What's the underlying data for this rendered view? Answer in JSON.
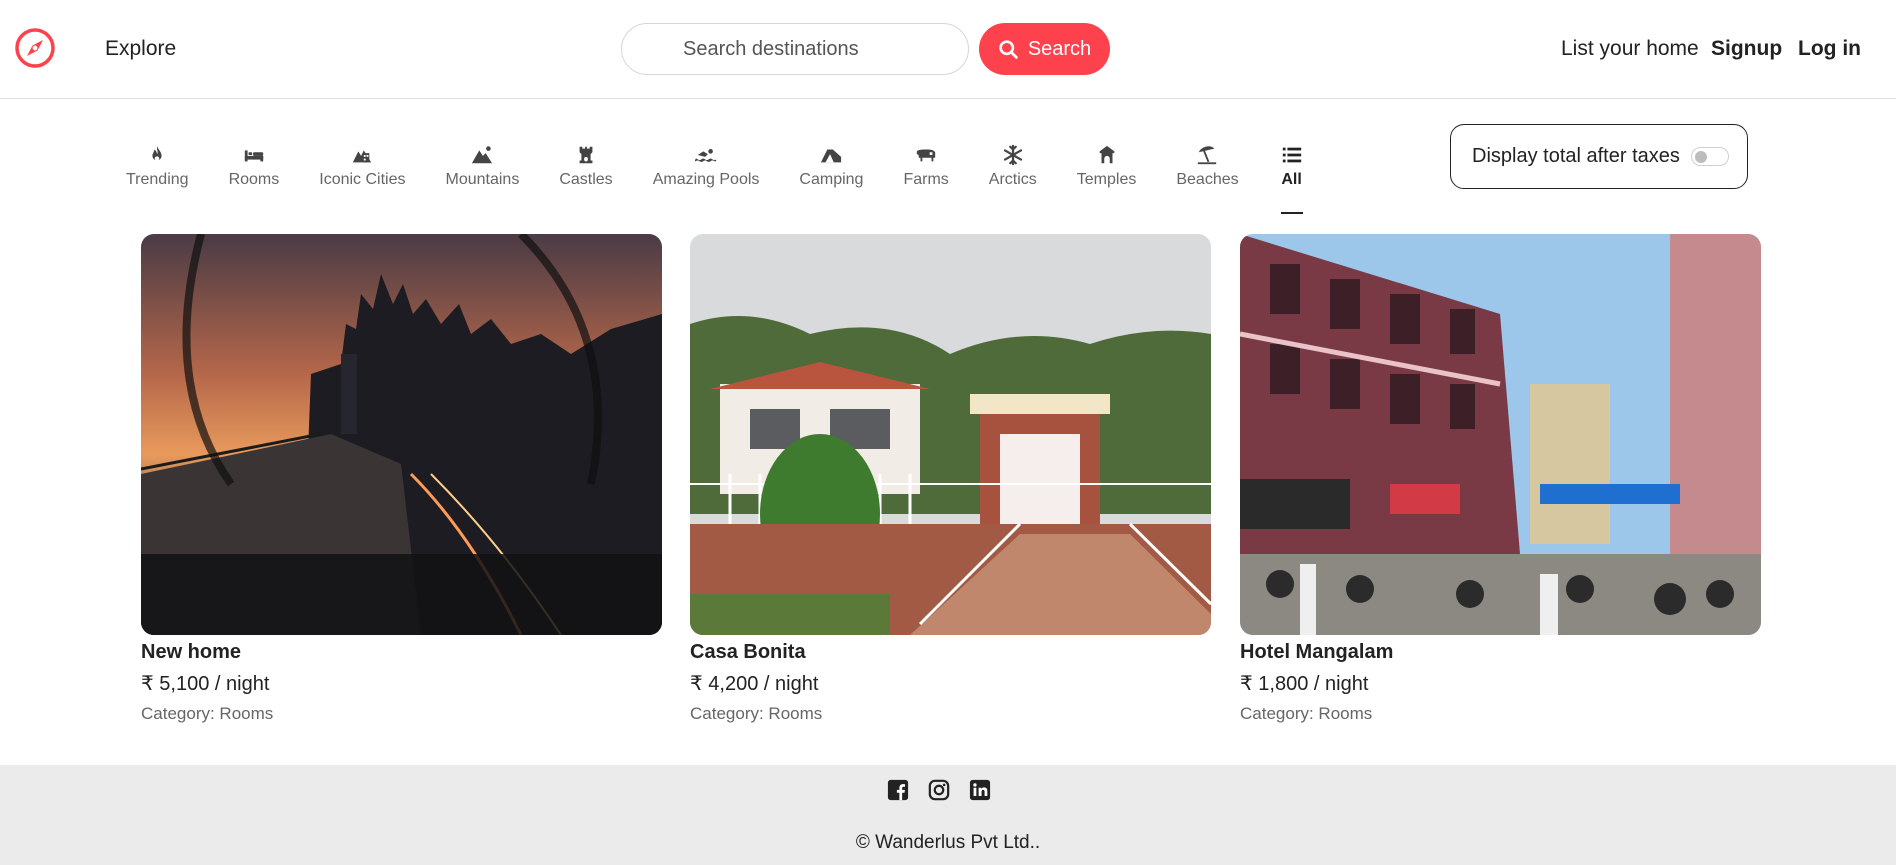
{
  "nav": {
    "explore": "Explore",
    "search_placeholder": "Search destinations",
    "search_button": "Search",
    "list_home": "List your home",
    "signup": "Signup",
    "login": "Log in",
    "brand_color": "#fe424d"
  },
  "filters": [
    {
      "label": "Trending",
      "icon": "fire-icon"
    },
    {
      "label": "Rooms",
      "icon": "bed-icon"
    },
    {
      "label": "Iconic Cities",
      "icon": "city-icon"
    },
    {
      "label": "Mountains",
      "icon": "mountain-icon"
    },
    {
      "label": "Castles",
      "icon": "castle-icon"
    },
    {
      "label": "Amazing Pools",
      "icon": "swimmer-icon"
    },
    {
      "label": "Camping",
      "icon": "campground-icon"
    },
    {
      "label": "Farms",
      "icon": "cow-icon"
    },
    {
      "label": "Arctics",
      "icon": "snowflake-icon"
    },
    {
      "label": "Temples",
      "icon": "temple-icon"
    },
    {
      "label": "Beaches",
      "icon": "umbrella-beach-icon"
    },
    {
      "label": "All",
      "icon": "list-icon",
      "active": true
    }
  ],
  "tax_toggle": {
    "label": "Display total after taxes",
    "on": false
  },
  "listings": [
    {
      "title": "New home",
      "price": "₹ 5,100 / night",
      "category": "Category: Rooms"
    },
    {
      "title": "Casa Bonita",
      "price": "₹ 4,200 / night",
      "category": "Category: Rooms"
    },
    {
      "title": "Hotel Mangalam",
      "price": "₹ 1,800 / night",
      "category": "Category: Rooms"
    }
  ],
  "footer": {
    "socials": [
      "facebook-icon",
      "instagram-icon",
      "linkedin-icon"
    ],
    "copyright": "© Wanderlus Pvt Ltd.."
  }
}
